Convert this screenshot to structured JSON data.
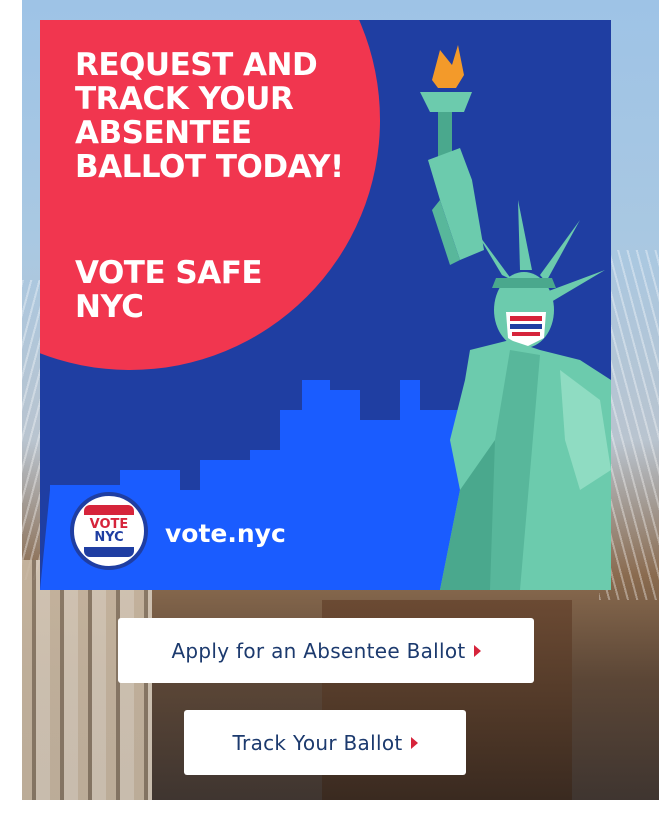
{
  "ad": {
    "headline": "REQUEST AND TRACK YOUR ABSENTEE BALLOT TODAY!",
    "subheadline": "VOTE SAFE NYC",
    "logo_line1": "VOTE",
    "logo_line2": "NYC",
    "website": "vote.nyc"
  },
  "buttons": {
    "apply_label": "Apply for an Absentee Ballot",
    "track_label": "Track Your Ballot"
  },
  "colors": {
    "ad_background": "#1f3ea2",
    "circle": "#f1364f",
    "skyline": "#1a5cff",
    "statue": "#6ccbad",
    "button_text": "#1c3a6e",
    "caret": "#d6243b"
  },
  "icons": {
    "caret": "caret-right-icon",
    "logo": "vote-nyc-logo",
    "statue": "statue-of-liberty-illustration"
  }
}
